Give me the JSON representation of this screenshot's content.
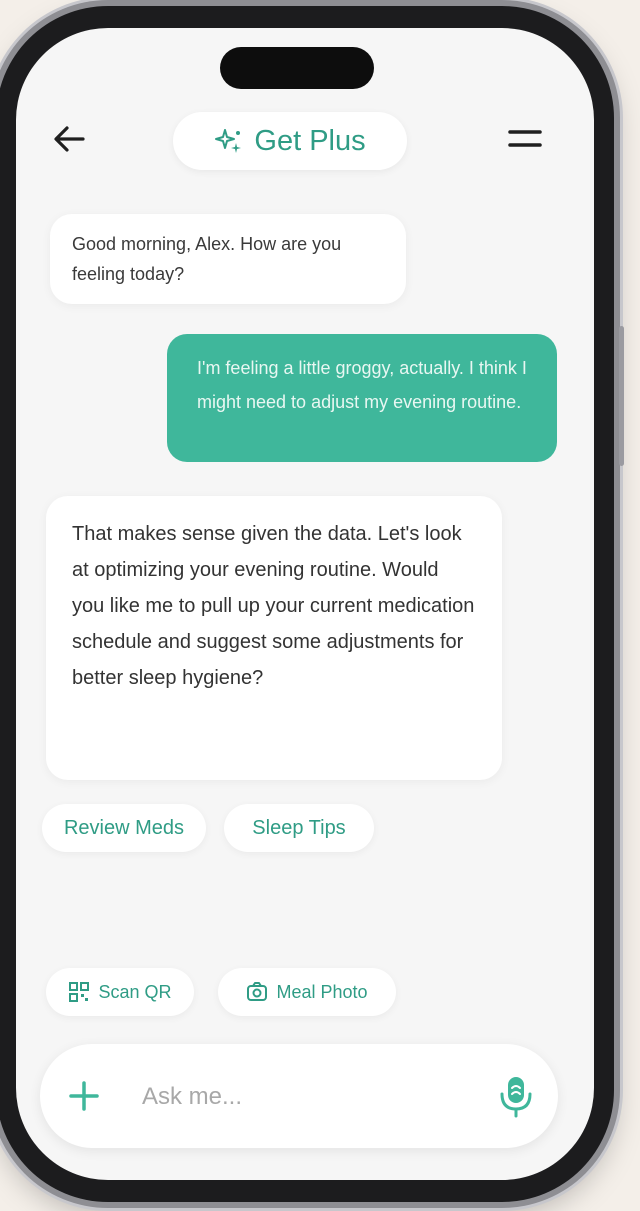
{
  "header": {
    "get_plus_label": "Get Plus",
    "back_icon": "arrow-left-icon",
    "menu_icon": "menu-icon"
  },
  "messages": [
    {
      "sender": "assistant",
      "text": "Good morning, Alex. How are you feeling today?"
    },
    {
      "sender": "user",
      "text": "I'm feeling a little groggy, actually. I think I might need to adjust my evening routine."
    },
    {
      "sender": "assistant",
      "text": "That makes sense given the data. Let's look at optimizing your evening routine. Would you like me to pull up your current medication schedule and suggest some adjustments for better sleep hygiene?"
    }
  ],
  "quick_replies": [
    {
      "label": "Review Meds"
    },
    {
      "label": "Sleep Tips"
    }
  ],
  "tools": [
    {
      "label": "Scan QR",
      "icon": "qr-icon"
    },
    {
      "label": "Meal Photo",
      "icon": "camera-icon"
    }
  ],
  "composer": {
    "placeholder": "Ask me...",
    "value": ""
  },
  "colors": {
    "accent": "#2f9c85",
    "user_bubble": "#3fb79b",
    "background": "#f6f6f6"
  }
}
